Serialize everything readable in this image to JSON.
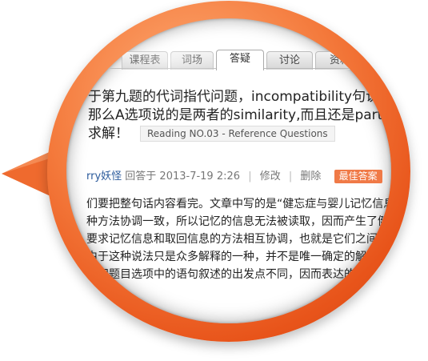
{
  "tabs": [
    {
      "label": "课程表",
      "active": false
    },
    {
      "label": "词场",
      "active": false
    },
    {
      "label": "答疑",
      "active": true
    },
    {
      "label": "讨论",
      "active": false
    },
    {
      "label": "资料",
      "active": false
    }
  ],
  "question": {
    "line1": "于第九题的代词指代问题，incompatibility句说",
    "line2": "那么A选项说的是两者的similarity,而且还是partly",
    "line3": "求解！",
    "tag": "Reading NO.03 - Reference Questions"
  },
  "meta": {
    "user": "rry妖怪",
    "answered_at": "回答于 2013-7-19 2:26",
    "edit": "修改",
    "delete": "删除",
    "best_answer": "最佳答案"
  },
  "answer_lines": [
    "们要把整句话内容看完。文章中写的是“健忘症与婴儿记忆信息和",
    "种方法协调一致，所以记忆的信息无法被读取，因而产生了健忘",
    "要求记忆信息和取回信息的方法相互协调，也就是它们之间",
    "由于这种说法只是众多解释的一种，并不是唯一确定的解",
    "句和题目选项中的语句叙述的出发点不同，因而表达的"
  ],
  "colors": {
    "ring_orange": "#f47a3c",
    "best_badge": "#f07a47",
    "username_blue": "#2a5a9b"
  },
  "icons": [
    "magnifier-pointer-icon"
  ]
}
